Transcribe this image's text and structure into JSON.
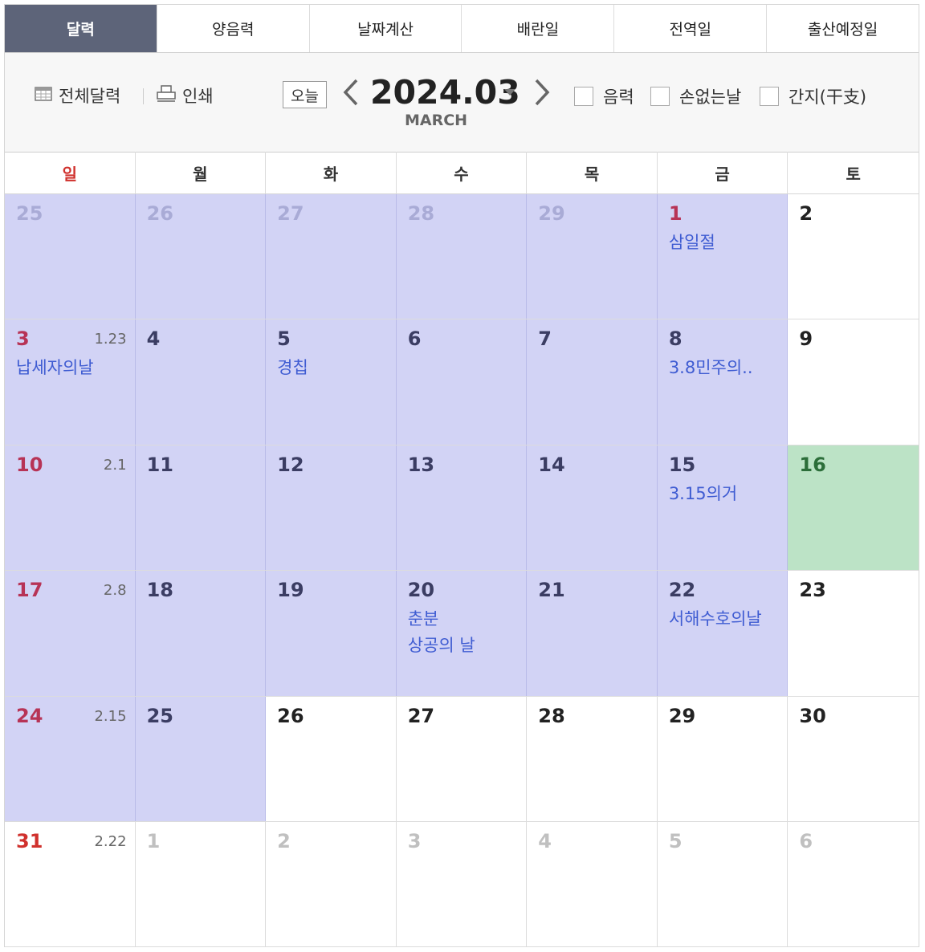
{
  "tabs": [
    "달력",
    "양음력",
    "날짜계산",
    "배란일",
    "전역일",
    "출산예정일"
  ],
  "toolbar": {
    "full_calendar_label": "전체달력",
    "print_label": "인쇄",
    "today_label": "오늘",
    "year_month": "2024.03",
    "month_en": "MARCH",
    "checks": [
      "음력",
      "손없는날",
      "간지(干支)"
    ]
  },
  "weekdays": [
    "일",
    "월",
    "화",
    "수",
    "목",
    "금",
    "토"
  ],
  "weeks": [
    [
      {
        "day": "25",
        "other": true,
        "highlight": true
      },
      {
        "day": "26",
        "other": true,
        "highlight": true
      },
      {
        "day": "27",
        "other": true,
        "highlight": true
      },
      {
        "day": "28",
        "other": true,
        "highlight": true
      },
      {
        "day": "29",
        "other": true,
        "highlight": true
      },
      {
        "day": "1",
        "highlight": true,
        "red": true,
        "events": [
          "삼일절"
        ]
      },
      {
        "day": "2"
      }
    ],
    [
      {
        "day": "3",
        "highlight": true,
        "red": true,
        "lunar": "1.23",
        "events": [
          "납세자의날"
        ]
      },
      {
        "day": "4",
        "highlight": true
      },
      {
        "day": "5",
        "highlight": true,
        "events": [
          "경칩"
        ]
      },
      {
        "day": "6",
        "highlight": true
      },
      {
        "day": "7",
        "highlight": true
      },
      {
        "day": "8",
        "highlight": true,
        "events": [
          "3.8민주의.."
        ]
      },
      {
        "day": "9"
      }
    ],
    [
      {
        "day": "10",
        "highlight": true,
        "red": true,
        "lunar": "2.1"
      },
      {
        "day": "11",
        "highlight": true
      },
      {
        "day": "12",
        "highlight": true
      },
      {
        "day": "13",
        "highlight": true
      },
      {
        "day": "14",
        "highlight": true
      },
      {
        "day": "15",
        "highlight": true,
        "events": [
          "3.15의거"
        ]
      },
      {
        "day": "16",
        "today": true
      }
    ],
    [
      {
        "day": "17",
        "highlight": true,
        "red": true,
        "lunar": "2.8"
      },
      {
        "day": "18",
        "highlight": true
      },
      {
        "day": "19",
        "highlight": true
      },
      {
        "day": "20",
        "highlight": true,
        "events": [
          "춘분",
          "상공의 날"
        ]
      },
      {
        "day": "21",
        "highlight": true
      },
      {
        "day": "22",
        "highlight": true,
        "events": [
          "서해수호의날"
        ]
      },
      {
        "day": "23"
      }
    ],
    [
      {
        "day": "24",
        "highlight": true,
        "red": true,
        "lunar": "2.15"
      },
      {
        "day": "25",
        "highlight": true
      },
      {
        "day": "26"
      },
      {
        "day": "27"
      },
      {
        "day": "28"
      },
      {
        "day": "29"
      },
      {
        "day": "30"
      }
    ],
    [
      {
        "day": "31",
        "sunplain": true,
        "lunar": "2.22"
      },
      {
        "day": "1",
        "other": true
      },
      {
        "day": "2",
        "other": true
      },
      {
        "day": "3",
        "other": true
      },
      {
        "day": "4",
        "other": true
      },
      {
        "day": "5",
        "other": true
      },
      {
        "day": "6",
        "other": true
      }
    ]
  ],
  "colors": {
    "tab_active_bg": "#5d6479",
    "range_highlight": "#d2d3f5",
    "today_highlight": "#bce3c6",
    "holiday_red": "#b73356",
    "event_blue": "#3f5cd2"
  }
}
